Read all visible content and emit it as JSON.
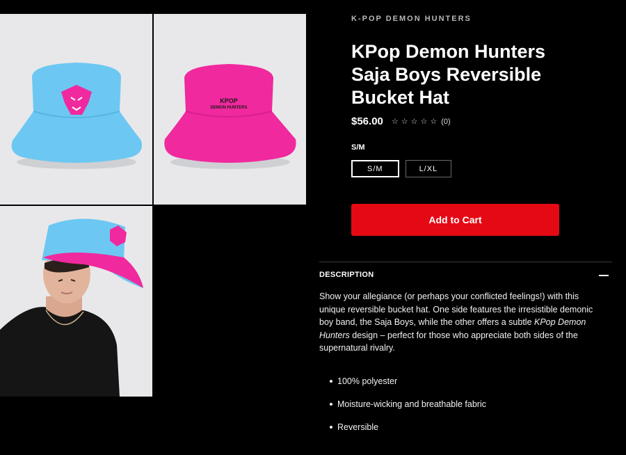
{
  "gallery": {
    "images": [
      {
        "label": "blue-side-hat",
        "primary_color": "#6cc8f2"
      },
      {
        "label": "pink-side-hat",
        "primary_color": "#f0299e"
      },
      {
        "label": "model-wearing-hat",
        "primary_color": "#6cc8f2"
      }
    ],
    "hat_print_line1": "KPOP",
    "hat_print_line2": "DEMON HUNTERS"
  },
  "product": {
    "brand": "K-POP DEMON HUNTERS",
    "title": "KPop Demon Hunters Saja Boys Reversible Bucket Hat",
    "price": "$56.00",
    "rating": {
      "stars": 0,
      "max": 5,
      "count_label": "(0)"
    },
    "size_label": "S/M",
    "sizes": [
      {
        "label": "S/M",
        "selected": true
      },
      {
        "label": "L/XL",
        "selected": false
      }
    ],
    "add_to_cart_label": "Add to Cart"
  },
  "description": {
    "heading": "DESCRIPTION",
    "text_part1": "Show your allegiance (or perhaps your conflicted feelings!) with this unique reversible bucket hat. One side features the irresistible demonic boy band, the Saja Boys, while the other offers a subtle ",
    "text_italic": "KPop Demon Hunters",
    "text_part2": " design – perfect for those who appreciate both sides of the supernatural rivalry.",
    "features": [
      "100% polyester",
      "Moisture-wicking and breathable fabric",
      "Reversible"
    ]
  },
  "colors": {
    "accent": "#e50914",
    "background": "#000000"
  }
}
